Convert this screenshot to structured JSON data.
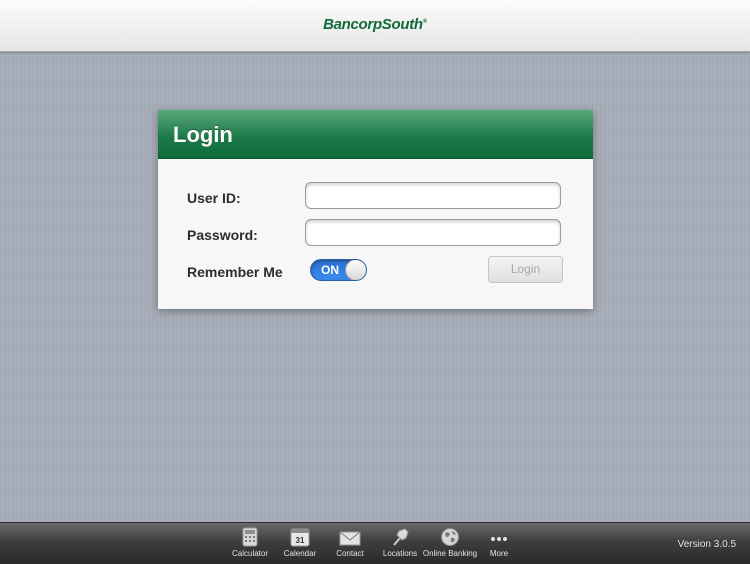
{
  "header": {
    "brand": "BancorpSouth",
    "brand_mark": "®"
  },
  "login": {
    "title": "Login",
    "user_id_label": "User ID:",
    "user_id_value": "",
    "password_label": "Password:",
    "password_value": "",
    "remember_label": "Remember Me",
    "remember_toggle": "ON",
    "login_button": "Login"
  },
  "tabbar": {
    "items": [
      {
        "label": "Calculator",
        "icon": "calculator-icon"
      },
      {
        "label": "Calendar",
        "icon": "calendar-icon",
        "icon_text": "31"
      },
      {
        "label": "Contact",
        "icon": "envelope-icon"
      },
      {
        "label": "Locations",
        "icon": "map-pin-icon"
      },
      {
        "label": "Online Banking",
        "icon": "globe-icon"
      },
      {
        "label": "More",
        "icon": "more-icon"
      }
    ],
    "version": "Version 3.0.5"
  },
  "colors": {
    "brand_green": "#0f6a3c",
    "toggle_blue": "#3d8df0"
  }
}
